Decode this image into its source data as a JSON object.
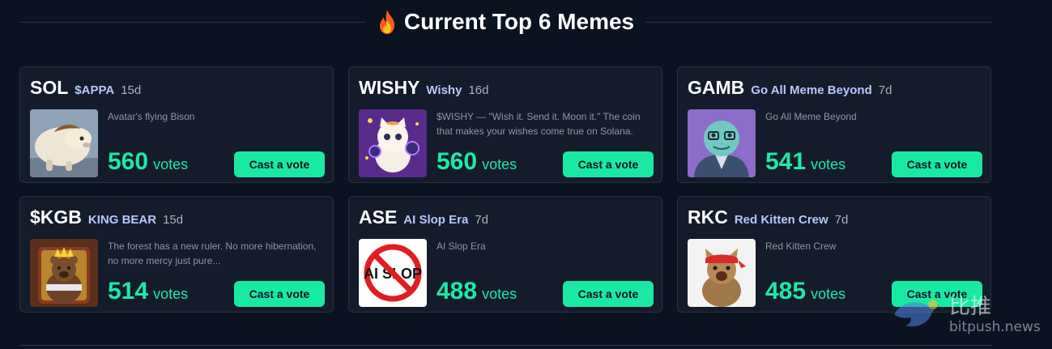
{
  "header": {
    "title": "Current Top 6 Memes",
    "icon": "fire-icon"
  },
  "colors": {
    "background": "#0b1220",
    "card": "#141b2b",
    "accent": "#1de9a6",
    "name": "#b7c7ff"
  },
  "cards": [
    {
      "ticker": "SOL",
      "name": "$APPA",
      "age": "15d",
      "description": "Avatar's flying Bison",
      "votes": "560",
      "votes_label": "votes",
      "button": "Cast a vote",
      "image": "flying-bison-image"
    },
    {
      "ticker": "WISHY",
      "name": "Wishy",
      "age": "16d",
      "description": "$WISHY — \"Wish it. Send it. Moon it.\" The coin that makes your wishes come true on Solana.",
      "votes": "560",
      "votes_label": "votes",
      "button": "Cast a vote",
      "image": "lucky-cat-image"
    },
    {
      "ticker": "GAMB",
      "name": "Go All Meme Beyond",
      "age": "7d",
      "description": "Go All Meme Beyond",
      "votes": "541",
      "votes_label": "votes",
      "button": "Cast a vote",
      "image": "frog-avatar-image"
    },
    {
      "ticker": "$KGB",
      "name": "KING BEAR",
      "age": "15d",
      "description": "The forest has a new ruler. No more hibernation, no more mercy just pure...",
      "votes": "514",
      "votes_label": "votes",
      "button": "Cast a vote",
      "image": "king-bear-image"
    },
    {
      "ticker": "ASE",
      "name": "AI Slop Era",
      "age": "7d",
      "description": "AI Slop Era",
      "votes": "488",
      "votes_label": "votes",
      "button": "Cast a vote",
      "image": "ai-slop-sign-image"
    },
    {
      "ticker": "RKC",
      "name": "Red Kitten Crew",
      "age": "7d",
      "description": "Red Kitten Crew",
      "votes": "485",
      "votes_label": "votes",
      "button": "Cast a vote",
      "image": "red-kitten-image"
    }
  ],
  "watermark": {
    "text_cn": "比推",
    "text_en": "bitpush.news"
  }
}
